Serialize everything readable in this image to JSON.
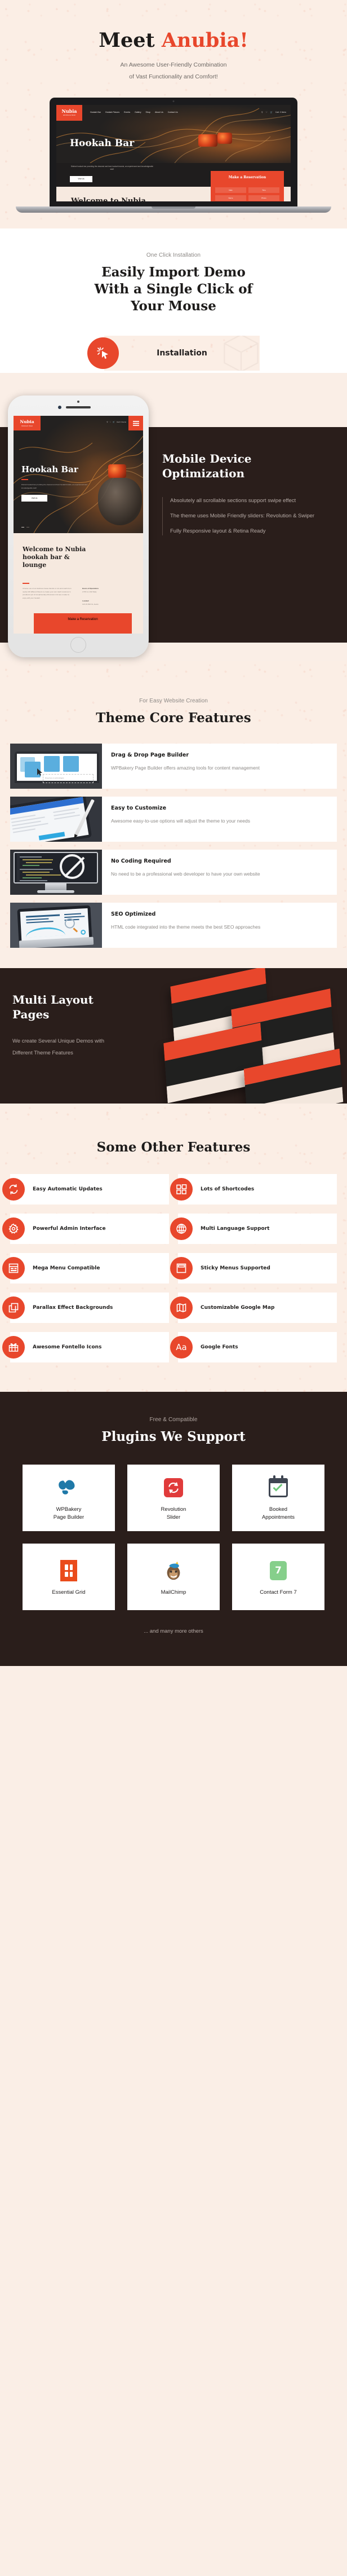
{
  "hero": {
    "title_part1": "Meet ",
    "title_accent": "Anubia!",
    "subtitle_line1": "An Awesome User-Friendly Combination",
    "subtitle_line2": "of Vast Functionality  and Comfort!"
  },
  "site_preview": {
    "logo_name": "Nubia",
    "logo_sub": "HOOKAH BAR",
    "nav": [
      "Hookah Bar",
      "Hookah Flavors",
      "Events",
      "Gallery",
      "Shop",
      "About Us",
      "Contact Us"
    ],
    "cart_label": "Cart: 0 items",
    "hero_title": "Hookah Bar",
    "hero_text": "Distinct hookah bar providing the cleanest and best hookah brands, an experienced and knowledgeable staff.",
    "hero_button": "Visit Us",
    "welcome_title_desktop": "Welcome to Nubia",
    "welcome_title_mobile": "Welcome to Nubia hookah bar & lounge",
    "reservation_title": "Make a Reservation",
    "reservation_fields": [
      "Date",
      "Time",
      "Name",
      "Phone"
    ],
    "info_hours_label": "Hours of Operations",
    "info_hours_value": "2 PM to 2 AM Daily",
    "info_located_label": "Located",
    "info_located_value": "123 W 45th St, Austin"
  },
  "installation": {
    "eyebrow": "One Click Installation",
    "heading_line1": "Easily Import Demo",
    "heading_line2": "With a Single Click of",
    "heading_line3": "Your Mouse",
    "button_label": "Installation",
    "icon": "click-cursor-icon"
  },
  "mobile": {
    "heading_line1": "Mobile Device",
    "heading_line2": "Optimization",
    "bullets": [
      "Absolutely all scrollable sections support swipe effect",
      "The theme uses Mobile Friendly sliders: Revolution & Swiper",
      "Fully Responsive layout & Retina Ready"
    ]
  },
  "core": {
    "eyebrow": "For Easy Website Creation",
    "heading": "Theme Core Features",
    "cards": [
      {
        "title": "Drag & Drop Page Builder",
        "text": "WPBakery Page Builder offers amazing tools for content management",
        "thumb": "drag-drop-builder-thumb"
      },
      {
        "title": "Easy to Customize",
        "text": "Awesome easy-to-use options will adjust the theme to your needs",
        "thumb": "easy-customize-thumb"
      },
      {
        "title": "No Coding Required",
        "text": "No need to be a professional web developer to have your own website",
        "thumb": "no-coding-thumb"
      },
      {
        "title": "SEO Optimized",
        "text": "HTML code integrated into the theme meets the best SEO approaches",
        "thumb": "seo-optimized-thumb"
      }
    ]
  },
  "multi_layout": {
    "heading_line1": "Multi Layout",
    "heading_line2": "Pages",
    "text": "We create Several Unique Demos with Different Theme Features"
  },
  "other_features": {
    "heading": "Some Other Features",
    "items": [
      {
        "label": "Easy Automatic Updates",
        "icon": "refresh-icon"
      },
      {
        "label": "Lots of Shortcodes",
        "icon": "shortcodes-grid-icon"
      },
      {
        "label": "Powerful Admin Interface",
        "icon": "gear-icon"
      },
      {
        "label": "Multi Language Support",
        "icon": "globe-icon"
      },
      {
        "label": "Mega Menu Compatible",
        "icon": "mega-menu-icon"
      },
      {
        "label": "Sticky Menus Supported",
        "icon": "sticky-menu-icon"
      },
      {
        "label": "Parallax Effect Backgrounds",
        "icon": "layers-icon"
      },
      {
        "label": "Customizable Google Map",
        "icon": "map-icon"
      },
      {
        "label": "Awesome Fontello Icons",
        "icon": "gift-icon"
      },
      {
        "label": "Google Fonts",
        "icon": "typography-aa-icon"
      }
    ]
  },
  "plugins": {
    "eyebrow": "Free & Compatible",
    "heading": "Plugins We Support",
    "items": [
      {
        "name": "WPBakery\nPage Builder",
        "icon": "wpbakery-logo"
      },
      {
        "name": "Revolution\nSlider",
        "icon": "revolution-slider-logo"
      },
      {
        "name": "Booked\nAppointments",
        "icon": "booked-appointments-logo"
      },
      {
        "name": "Essential Grid",
        "icon": "essential-grid-logo"
      },
      {
        "name": "MailChimp",
        "icon": "mailchimp-logo"
      },
      {
        "name": "Contact Form 7",
        "icon": "contact-form-7-logo"
      }
    ],
    "footer_note": "... and many more others"
  },
  "colors": {
    "accent": "#e8472c",
    "dark": "#2a1e1b",
    "paper": "#fbeee5",
    "text": "#1e1c1b",
    "muted": "#8c8885"
  }
}
